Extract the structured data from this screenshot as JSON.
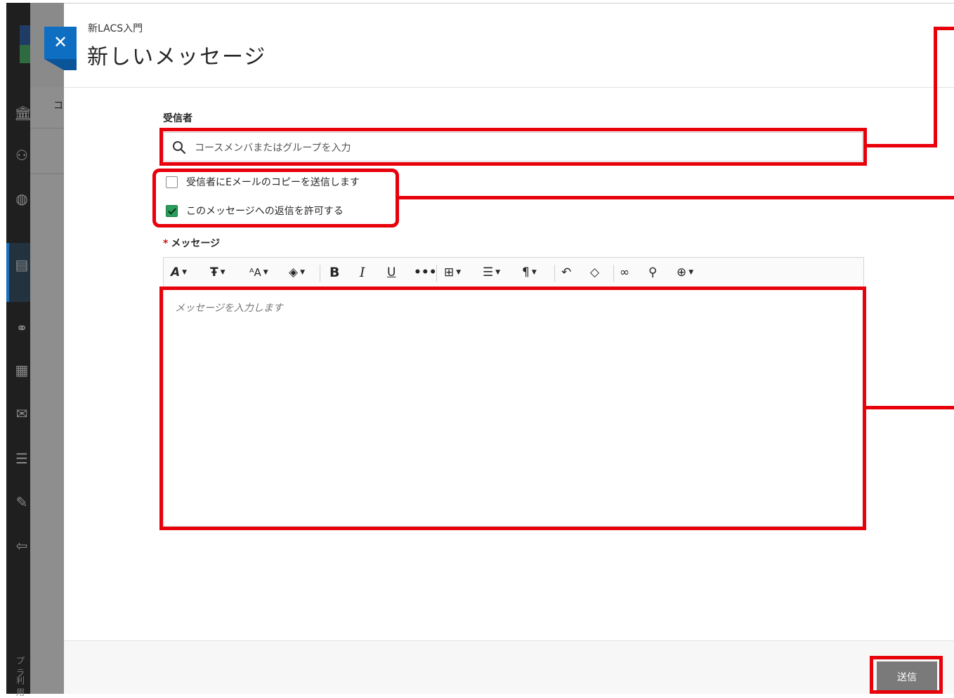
{
  "background": {
    "nav_footer_1": "プラ",
    "nav_footer_2": "利用",
    "main_letter": "コ"
  },
  "panel": {
    "course_name": "新LACS入門",
    "title": "新しいメッセージ",
    "close_icon": "close-icon"
  },
  "recipients": {
    "label": "受信者",
    "placeholder": "コースメンバまたはグループを入力"
  },
  "options": {
    "email_copy": {
      "label": "受信者にEメールのコピーを送信します",
      "checked": false
    },
    "allow_reply": {
      "label": "このメッセージへの返信を許可する",
      "checked": true
    }
  },
  "message": {
    "required_mark": "*",
    "label": "メッセージ",
    "placeholder": "メッセージを入力します",
    "toolbar": [
      "text-style-icon",
      "font-family-icon",
      "font-size-icon",
      "text-color-icon",
      "bold-icon",
      "italic-icon",
      "underline-icon",
      "more-icon",
      "table-icon",
      "align-icon",
      "paragraph-icon",
      "undo-icon",
      "clear-format-icon",
      "link-icon",
      "attach-icon",
      "insert-icon"
    ]
  },
  "footer": {
    "send_label": "送信"
  },
  "colors": {
    "accent": "#0e6fc2",
    "annotation": "#e8000b",
    "checkbox_checked": "#2a9d5c",
    "send_button": "#7a7a7a"
  }
}
